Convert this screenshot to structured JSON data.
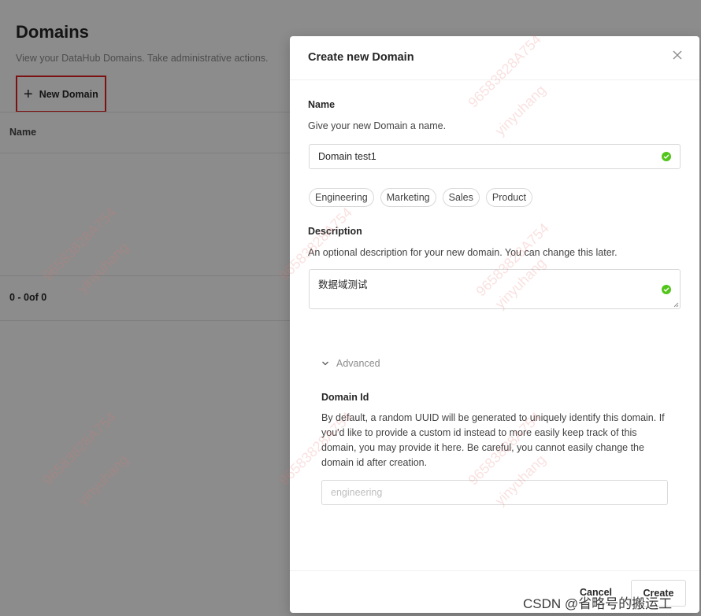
{
  "background": {
    "title": "Domains",
    "subtitle": "View your DataHub Domains. Take administrative actions.",
    "new_domain_label": "New Domain",
    "table_header_name": "Name",
    "pagination": "0 - 0of 0"
  },
  "modal": {
    "title": "Create new Domain",
    "name_section": {
      "label": "Name",
      "help": "Give your new Domain a name.",
      "value": "Domain test1"
    },
    "suggestions": [
      "Engineering",
      "Marketing",
      "Sales",
      "Product"
    ],
    "description_section": {
      "label": "Description",
      "help": "An optional description for your new domain. You can change this later.",
      "value": "数据域测试"
    },
    "advanced_label": "Advanced",
    "domain_id_section": {
      "label": "Domain Id",
      "help": "By default, a random UUID will be generated to uniquely identify this domain. If you'd like to provide a custom id instead to more easily keep track of this domain, you may provide it here. Be careful, you cannot easily change the domain id after creation.",
      "placeholder": "engineering"
    },
    "cancel_label": "Cancel",
    "create_label": "Create"
  },
  "watermarks": [
    "96583828A754",
    "yinyuhang"
  ],
  "credit": "CSDN @省略号的搬运工",
  "colors": {
    "valid_check": "#52c41a",
    "highlight_border": "#e02020",
    "overlay": "rgba(0,0,0,0.45)"
  }
}
